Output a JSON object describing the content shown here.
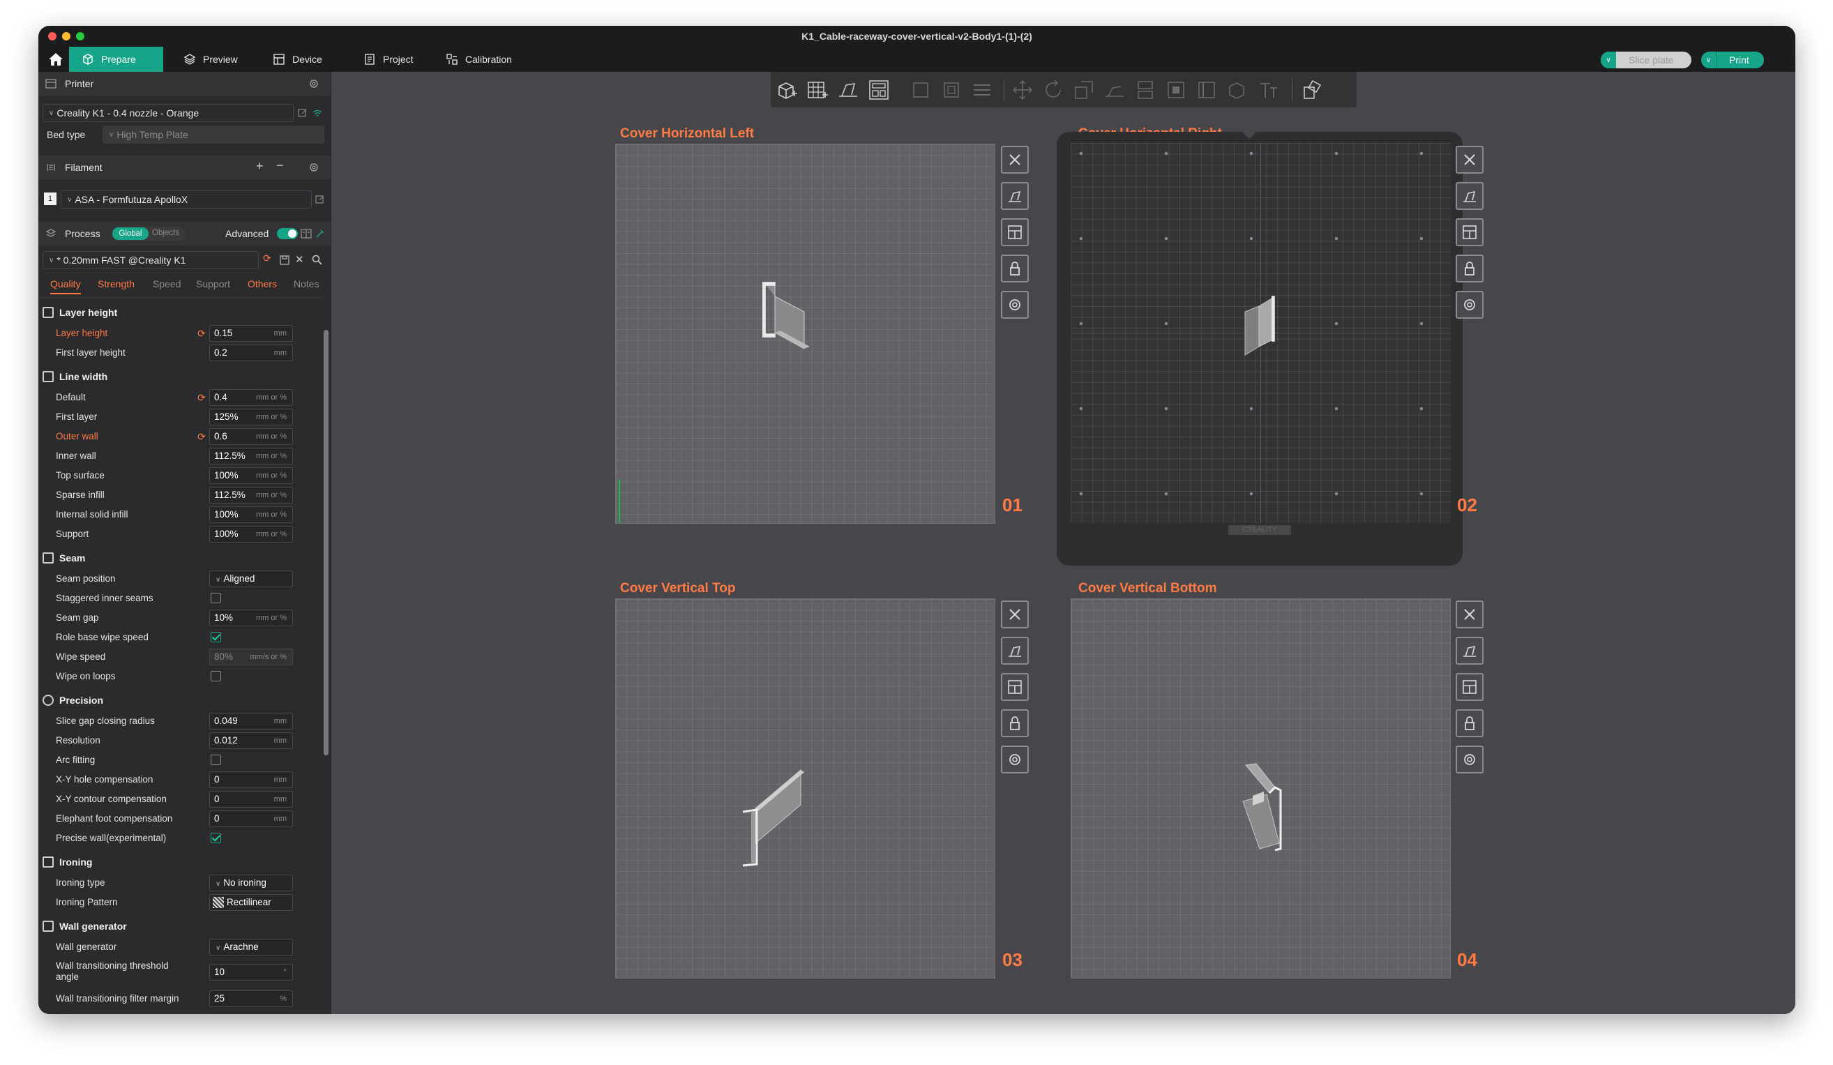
{
  "window": {
    "title": "K1_Cable-raceway-cover-vertical-v2-Body1-(1)-(2)"
  },
  "menu": {
    "tabs": [
      {
        "label": "Prepare"
      },
      {
        "label": "Preview"
      },
      {
        "label": "Device"
      },
      {
        "label": "Project"
      },
      {
        "label": "Calibration"
      }
    ],
    "slice_label": "Slice plate",
    "print_label": "Print"
  },
  "sidebar": {
    "printer": {
      "heading": "Printer",
      "preset": "Creality K1 - 0.4 nozzle - Orange",
      "bed_label": "Bed type",
      "bed_value": "High Temp Plate"
    },
    "filament": {
      "heading": "Filament",
      "slot": "1",
      "preset": "ASA - Formfutuza ApolloX"
    },
    "process": {
      "heading": "Process",
      "toggle_global": "Global",
      "toggle_objects": "Objects",
      "advanced_label": "Advanced",
      "preset": "* 0.20mm FAST @Creality K1"
    },
    "tabs": [
      "Quality",
      "Strength",
      "Speed",
      "Support",
      "Others",
      "Notes"
    ],
    "groups": {
      "layer_height": "Layer height",
      "line_width": "Line width",
      "seam": "Seam",
      "precision": "Precision",
      "ironing": "Ironing",
      "wall_generator": "Wall generator"
    },
    "params": {
      "layer_height": {
        "label": "Layer height",
        "value": "0.15",
        "unit": "mm"
      },
      "first_layer_height": {
        "label": "First layer height",
        "value": "0.2",
        "unit": "mm"
      },
      "lw_default": {
        "label": "Default",
        "value": "0.4",
        "unit": "mm or %"
      },
      "lw_first_layer": {
        "label": "First layer",
        "value": "125%",
        "unit": "mm or %"
      },
      "lw_outer_wall": {
        "label": "Outer wall",
        "value": "0.6",
        "unit": "mm or %"
      },
      "lw_inner_wall": {
        "label": "Inner wall",
        "value": "112.5%",
        "unit": "mm or %"
      },
      "lw_top_surface": {
        "label": "Top surface",
        "value": "100%",
        "unit": "mm or %"
      },
      "lw_sparse_infill": {
        "label": "Sparse infill",
        "value": "112.5%",
        "unit": "mm or %"
      },
      "lw_internal_solid": {
        "label": "Internal solid infill",
        "value": "100%",
        "unit": "mm or %"
      },
      "lw_support": {
        "label": "Support",
        "value": "100%",
        "unit": "mm or %"
      },
      "seam_position": {
        "label": "Seam position",
        "value": "Aligned"
      },
      "staggered_inner_seams": {
        "label": "Staggered inner seams"
      },
      "seam_gap": {
        "label": "Seam gap",
        "value": "10%",
        "unit": "mm or %"
      },
      "role_base_wipe_speed": {
        "label": "Role base wipe speed"
      },
      "wipe_speed": {
        "label": "Wipe speed",
        "value": "80%",
        "unit": "mm/s or %"
      },
      "wipe_on_loops": {
        "label": "Wipe on loops"
      },
      "slice_gap_closing_radius": {
        "label": "Slice gap closing radius",
        "value": "0.049",
        "unit": "mm"
      },
      "resolution": {
        "label": "Resolution",
        "value": "0.012",
        "unit": "mm"
      },
      "arc_fitting": {
        "label": "Arc fitting"
      },
      "xy_hole_comp": {
        "label": "X-Y hole compensation",
        "value": "0",
        "unit": "mm"
      },
      "xy_contour_comp": {
        "label": "X-Y contour compensation",
        "value": "0",
        "unit": "mm"
      },
      "elephant_foot": {
        "label": "Elephant foot compensation",
        "value": "0",
        "unit": "mm"
      },
      "precise_wall": {
        "label": "Precise wall(experimental)"
      },
      "ironing_type": {
        "label": "Ironing type",
        "value": "No ironing"
      },
      "ironing_pattern": {
        "label": "Ironing Pattern",
        "value": "Rectilinear"
      },
      "wall_generator": {
        "label": "Wall generator",
        "value": "Arachne"
      },
      "wall_transition_angle": {
        "label": "Wall transitioning threshold angle",
        "value": "10",
        "unit": "°"
      },
      "wall_transition_margin": {
        "label": "Wall transitioning filter margin",
        "value": "25",
        "unit": "%"
      }
    }
  },
  "plates": [
    {
      "title": "Cover Horizontal Left",
      "number": "01"
    },
    {
      "title": "Cover Horizontal Right",
      "number": "02"
    },
    {
      "title": "Cover Vertical Top",
      "number": "03"
    },
    {
      "title": "Cover Vertical Bottom",
      "number": "04"
    }
  ],
  "plate_brand": "CREALITY",
  "colors": {
    "accent": "#17a589",
    "modified": "#ff7a45"
  }
}
